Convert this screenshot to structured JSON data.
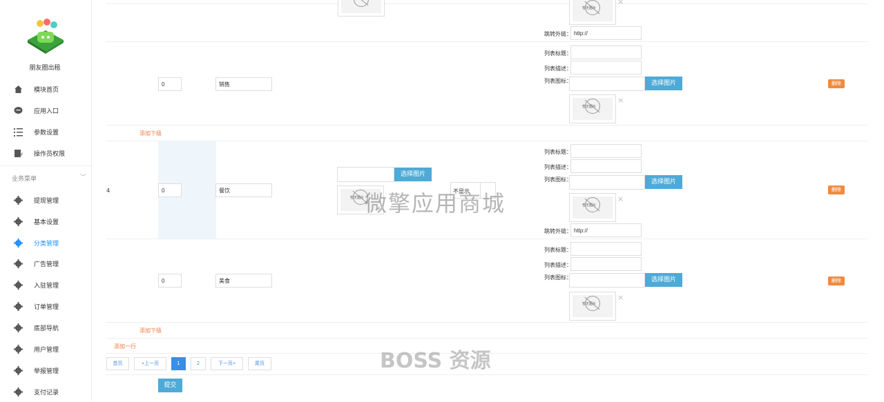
{
  "sidebar": {
    "app_name": "朋友圈出租",
    "top_items": [
      {
        "label": "模块首页",
        "icon": "home-icon"
      },
      {
        "label": "应用入口",
        "icon": "chat-icon"
      },
      {
        "label": "参数设置",
        "icon": "list-icon"
      },
      {
        "label": "操作员权限",
        "icon": "edit-icon"
      }
    ],
    "section_title": "业务菜单",
    "business_items": [
      {
        "label": "提现管理",
        "icon": "gear-icon"
      },
      {
        "label": "基本设置",
        "icon": "gear-icon"
      },
      {
        "label": "分类管理",
        "icon": "gear-icon",
        "active": true
      },
      {
        "label": "广告管理",
        "icon": "gear-icon"
      },
      {
        "label": "入驻管理",
        "icon": "gear-icon"
      },
      {
        "label": "订单管理",
        "icon": "gear-icon"
      },
      {
        "label": "底部导航",
        "icon": "gear-icon"
      },
      {
        "label": "用户管理",
        "icon": "gear-icon"
      },
      {
        "label": "举报管理",
        "icon": "gear-icon"
      },
      {
        "label": "支付记录",
        "icon": "gear-icon"
      }
    ]
  },
  "labels": {
    "redirect_link": "跳转外链：",
    "list_title": "列表标题：",
    "list_desc": "列表描述：",
    "list_icon": "列表图标：",
    "choose_image": "选择图片",
    "delete": "删除",
    "add_sub": "添加下级",
    "add_row": "添加一行",
    "submit": "提交",
    "no_image": "暂无图片",
    "close": "×"
  },
  "rows": {
    "top_link_value": "http://",
    "sub1": {
      "sort": "0",
      "name": "销售"
    },
    "parent": {
      "index": "4",
      "sort": "0",
      "name": "餐饮",
      "display": "不显示",
      "link_value": "http://"
    },
    "sub2": {
      "sort": "0",
      "name": "美食"
    }
  },
  "pagination": {
    "first": "首页",
    "prev": "«上一页",
    "pages": [
      "1",
      "2"
    ],
    "current": "1",
    "next": "下一页»",
    "last": "尾页"
  },
  "watermarks": {
    "center": "微擎应用商城",
    "bottom": "BOSS 资源"
  },
  "colors": {
    "accent_blue": "#4eaad6",
    "active_nav": "#1e90ff",
    "delete_orange": "#f08a3e",
    "link_orange": "#f07a3e"
  }
}
